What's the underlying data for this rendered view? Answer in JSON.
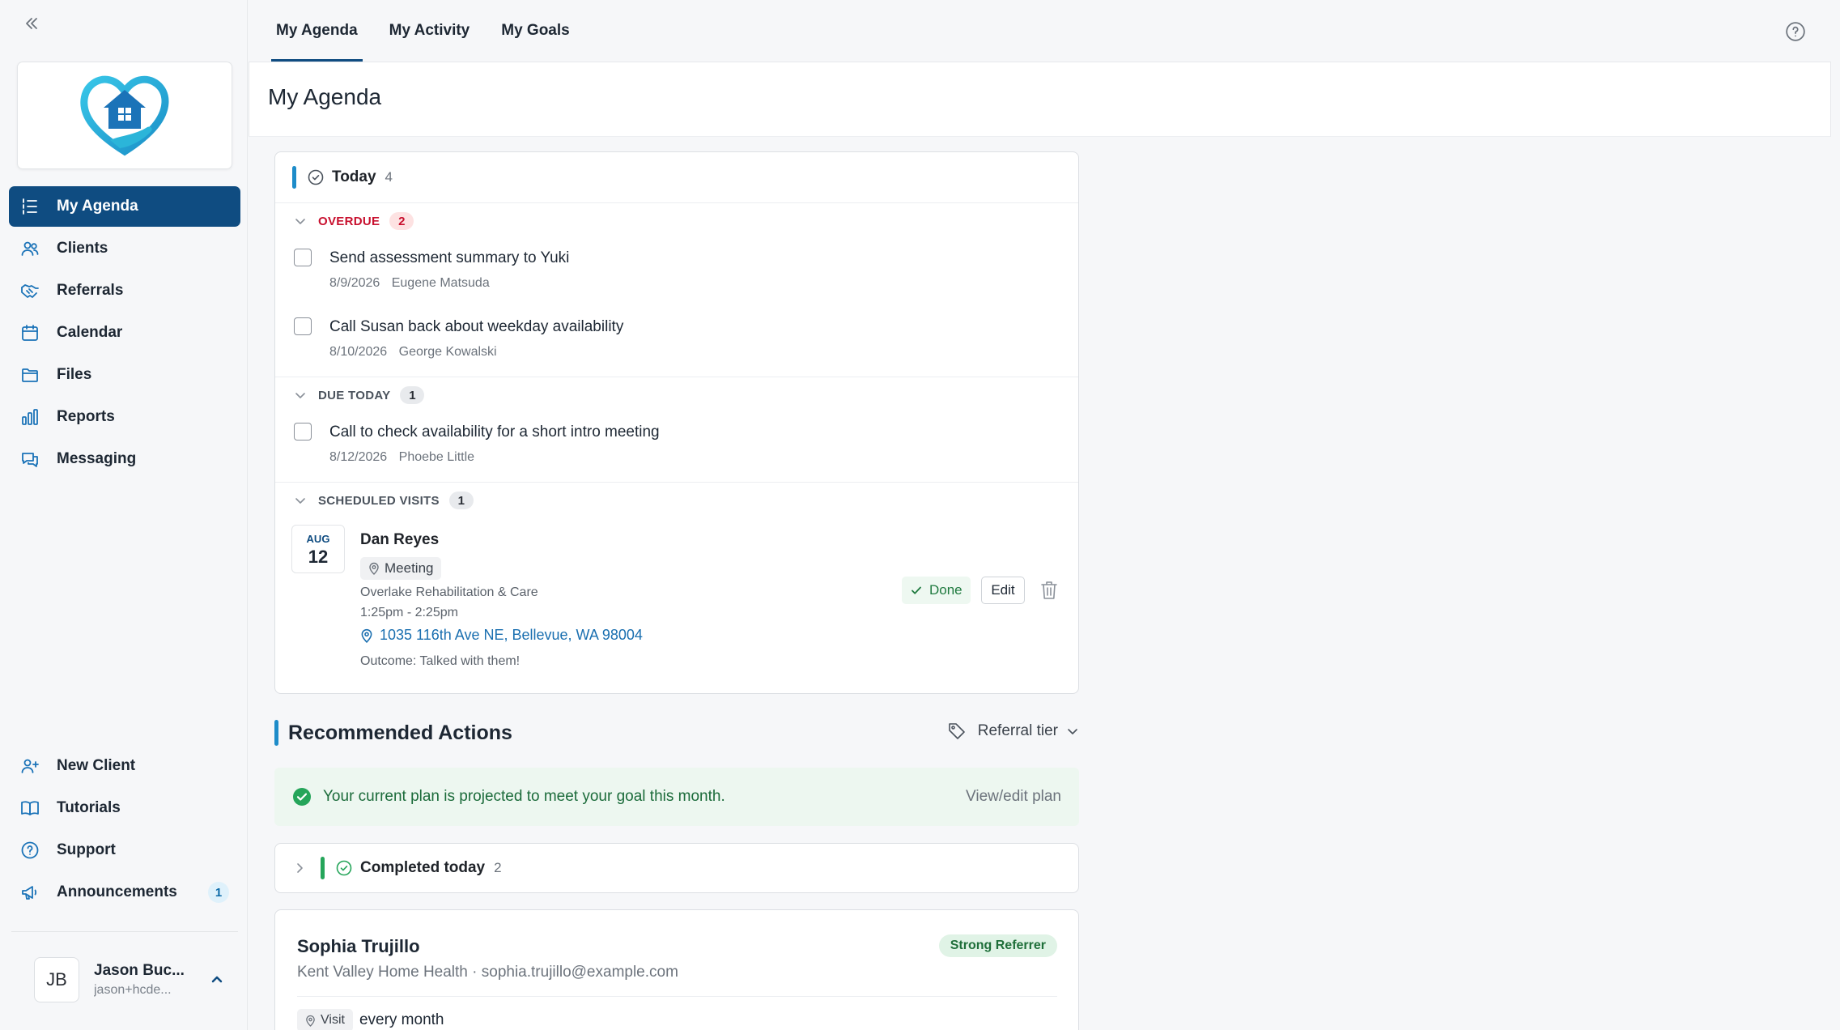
{
  "sidebar": {
    "nav": [
      {
        "label": "My Agenda",
        "icon": "agenda-list-icon"
      },
      {
        "label": "Clients",
        "icon": "users-icon"
      },
      {
        "label": "Referrals",
        "icon": "handshake-icon"
      },
      {
        "label": "Calendar",
        "icon": "calendar-icon"
      },
      {
        "label": "Files",
        "icon": "folder-icon"
      },
      {
        "label": "Reports",
        "icon": "bar-chart-icon"
      },
      {
        "label": "Messaging",
        "icon": "chat-icon"
      }
    ],
    "bottom_nav": [
      {
        "label": "New Client",
        "icon": "user-plus-icon"
      },
      {
        "label": "Tutorials",
        "icon": "book-icon"
      },
      {
        "label": "Support",
        "icon": "help-circle-icon"
      },
      {
        "label": "Announcements",
        "icon": "megaphone-icon",
        "badge": "1"
      }
    ],
    "user": {
      "initials": "JB",
      "name": "Jason Buc...",
      "email": "jason+hcde..."
    }
  },
  "tabs": [
    "My Agenda",
    "My Activity",
    "My Goals"
  ],
  "page": {
    "title": "My Agenda"
  },
  "today": {
    "title": "Today",
    "count": "4",
    "overdue": {
      "label": "OVERDUE",
      "count": "2",
      "tasks": [
        {
          "title": "Send assessment summary to Yuki",
          "date": "8/9/2026",
          "person": "Eugene Matsuda"
        },
        {
          "title": "Call Susan back about weekday availability",
          "date": "8/10/2026",
          "person": "George Kowalski"
        }
      ]
    },
    "due_today": {
      "label": "DUE TODAY",
      "count": "1",
      "tasks": [
        {
          "title": "Call to check availability for a short intro meeting",
          "date": "8/12/2026",
          "person": "Phoebe Little"
        }
      ]
    },
    "scheduled": {
      "label": "SCHEDULED VISITS",
      "count": "1",
      "visit": {
        "month": "AUG",
        "day": "12",
        "name": "Dan Reyes",
        "type": "Meeting",
        "org": "Overlake Rehabilitation & Care",
        "time": "1:25pm - 2:25pm",
        "address": "1035 116th Ave NE, Bellevue, WA 98004",
        "outcome": "Outcome: Talked with them!",
        "done_label": "Done",
        "edit_label": "Edit"
      }
    }
  },
  "recommended": {
    "title": "Recommended Actions",
    "filter_label": "Referral tier",
    "plan_message": "Your current plan is projected to meet your goal this month.",
    "plan_link": "View/edit plan",
    "completed": {
      "title": "Completed today",
      "count": "2"
    },
    "referrer": {
      "name": "Sophia Trujillo",
      "subtitle": "Kent Valley Home Health · sophia.trujillo@example.com",
      "badge": "Strong Referrer",
      "visit_tag": "Visit",
      "visit_freq": "every month"
    }
  },
  "colors": {
    "primary": "#0f4c81",
    "accent": "#1e8cc9",
    "danger": "#c8102e",
    "success": "#25a55a"
  }
}
